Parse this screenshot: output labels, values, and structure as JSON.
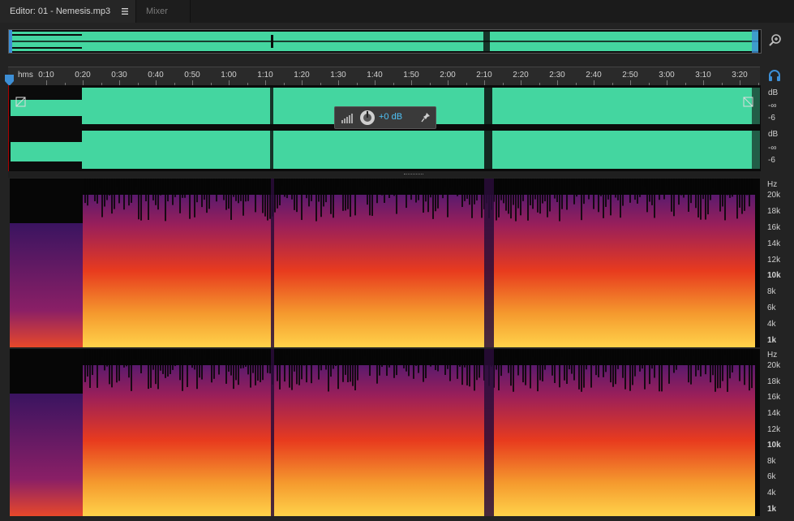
{
  "tabs": {
    "editor_label": "Editor: 01 - Nemesis.mp3",
    "mixer_label": "Mixer"
  },
  "ruler": {
    "unit": "hms",
    "ticks": [
      "0:10",
      "0:20",
      "0:30",
      "0:40",
      "0:50",
      "1:00",
      "1:10",
      "1:20",
      "1:30",
      "1:40",
      "1:50",
      "2:00",
      "2:10",
      "2:20",
      "2:30",
      "2:40",
      "2:50",
      "3:00",
      "3:10",
      "3:20"
    ]
  },
  "db_scale": {
    "labels": [
      "dB",
      "-∞",
      "-6",
      "dB",
      "-∞",
      "-6"
    ]
  },
  "hud": {
    "volume_value": "+0 dB"
  },
  "spectrogram_scale": {
    "unit": "Hz",
    "labels": [
      "20k",
      "18k",
      "16k",
      "14k",
      "12k",
      "10k",
      "8k",
      "6k",
      "4k",
      "1k"
    ]
  },
  "colors": {
    "waveform": "#44d6a0",
    "spectrogram_low": "#ffd24a",
    "spectrogram_mid": "#e83b1e",
    "spectrogram_high": "#5a1a6e",
    "accent_blue": "#3d8fd6"
  },
  "icons": {
    "tab_menu": "hamburger-icon",
    "zoom": "zoom-in-icon",
    "headphones": "headphones-icon",
    "pin": "pin-icon",
    "volume_knob": "knob-icon"
  }
}
